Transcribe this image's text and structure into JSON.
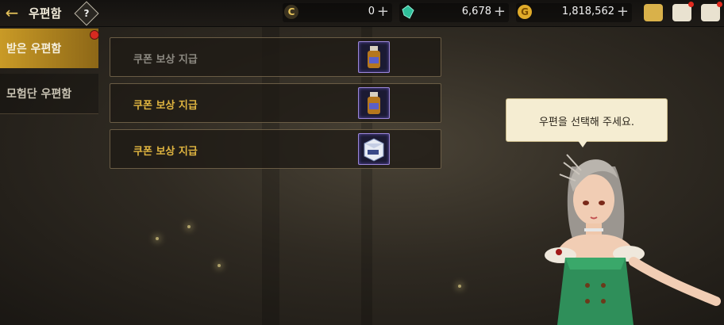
{
  "header": {
    "title": "우편함",
    "help_label": "?"
  },
  "currencies": [
    {
      "icon": "c-coin-icon",
      "value": "0"
    },
    {
      "icon": "crystal-icon",
      "value": "6,678"
    },
    {
      "icon": "gold-coin-icon",
      "value": "1,818,562"
    }
  ],
  "plus_symbol": "+",
  "tabs": [
    {
      "label": "받은 우편함",
      "active": true,
      "notification": true
    },
    {
      "label": "모험단 우편함",
      "active": false
    }
  ],
  "mails": [
    {
      "title": "쿠폰 보상 지급",
      "read": true,
      "item": "potion-bottle-icon"
    },
    {
      "title": "쿠폰 보상 지급",
      "read": false,
      "item": "potion-bottle-icon"
    },
    {
      "title": "쿠폰 보상 지급",
      "read": false,
      "item": "equipment-box-icon"
    }
  ],
  "npc": {
    "speech": "우편을 선택해 주세요."
  },
  "colors": {
    "accent": "#e0b540",
    "tab_active": "#c99a26",
    "badge": "#e02a1f"
  }
}
